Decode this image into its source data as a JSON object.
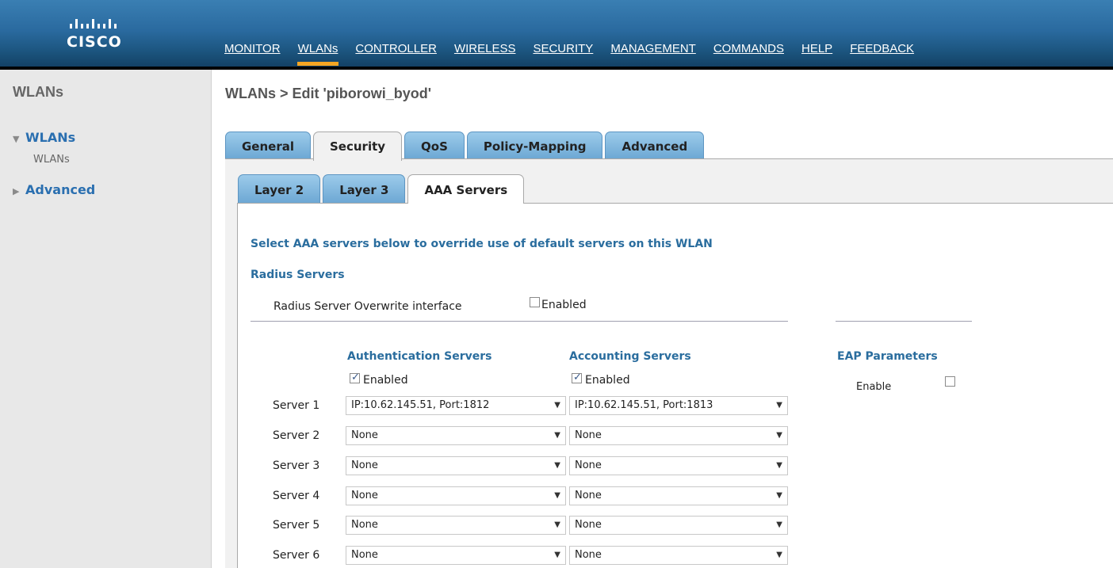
{
  "brand": {
    "name": "CISCO"
  },
  "topnav": [
    {
      "label": "MONITOR",
      "active": false
    },
    {
      "label": "WLANs",
      "active": true
    },
    {
      "label": "CONTROLLER",
      "active": false
    },
    {
      "label": "WIRELESS",
      "active": false
    },
    {
      "label": "SECURITY",
      "active": false
    },
    {
      "label": "MANAGEMENT",
      "active": false
    },
    {
      "label": "COMMANDS",
      "active": false
    },
    {
      "label": "HELP",
      "active": false
    },
    {
      "label": "FEEDBACK",
      "active": false
    }
  ],
  "sidebar": {
    "title": "WLANs",
    "items": [
      {
        "label": "WLANs",
        "icon": "triangle-down-icon",
        "expanded": true,
        "sub": "WLANs"
      },
      {
        "label": "Advanced",
        "icon": "triangle-right-icon",
        "expanded": false
      }
    ]
  },
  "breadcrumb": "WLANs > Edit  'piborowi_byod'",
  "tabs": [
    "General",
    "Security",
    "QoS",
    "Policy-Mapping",
    "Advanced"
  ],
  "active_tab": "Security",
  "subtabs": [
    "Layer 2",
    "Layer 3",
    "AAA Servers"
  ],
  "active_subtab": "AAA Servers",
  "aaa": {
    "intro": "Select AAA servers below to override use of default servers on this WLAN",
    "radius_heading": "Radius Servers",
    "overwrite_label": "Radius Server Overwrite interface",
    "overwrite_enabled": false,
    "enabled_label": "Enabled",
    "auth_heading": "Authentication Servers",
    "acct_heading": "Accounting Servers",
    "eap_heading": "EAP Parameters",
    "eap_enable_label": "Enable",
    "eap_enabled": false,
    "auth_enabled": true,
    "acct_enabled": true,
    "servers": [
      {
        "label": "Server 1",
        "auth": "IP:10.62.145.51, Port:1812",
        "acct": "IP:10.62.145.51, Port:1813"
      },
      {
        "label": "Server 2",
        "auth": "None",
        "acct": "None"
      },
      {
        "label": "Server 3",
        "auth": "None",
        "acct": "None"
      },
      {
        "label": "Server 4",
        "auth": "None",
        "acct": "None"
      },
      {
        "label": "Server 5",
        "auth": "None",
        "acct": "None"
      },
      {
        "label": "Server 6",
        "auth": "None",
        "acct": "None"
      }
    ]
  },
  "colors": {
    "header": "#1c557f",
    "accent": "#f5a623",
    "link": "#2a6fb0",
    "label": "#2a6d9e",
    "tab": "#6da8d4"
  }
}
